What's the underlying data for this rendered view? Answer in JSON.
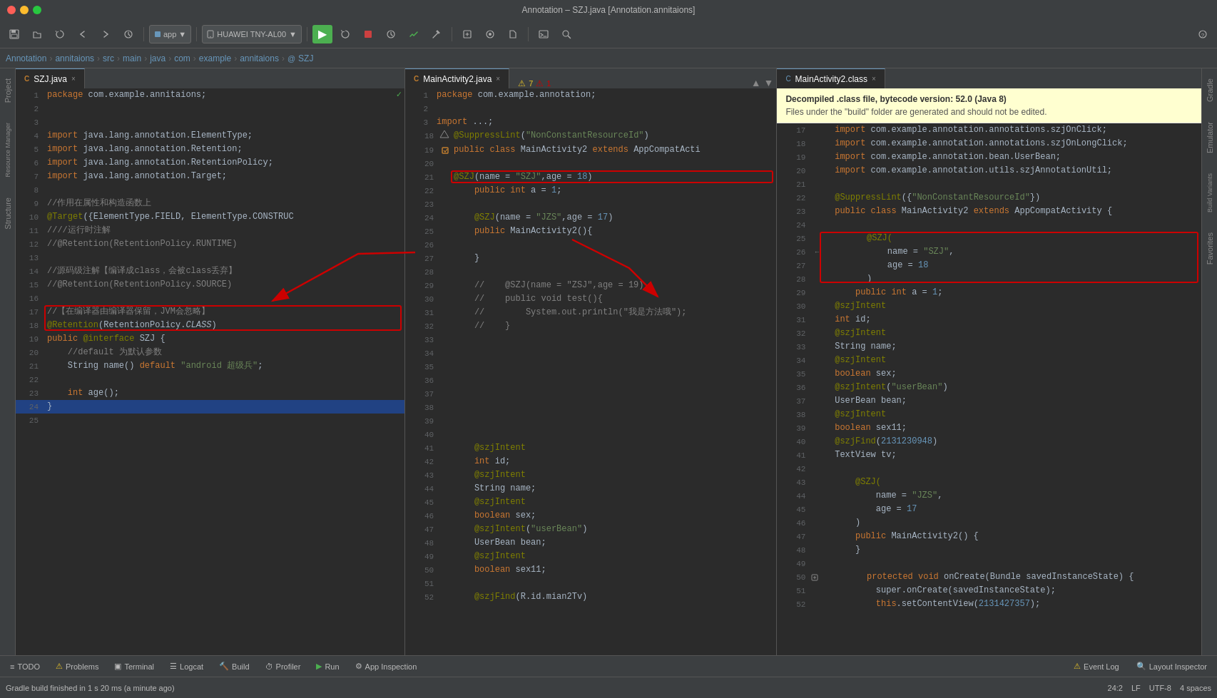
{
  "window": {
    "title": "Annotation – SZJ.java [Annotation.annitaions]"
  },
  "toolbar": {
    "app_label": "app",
    "app_dropdown_arrow": "▼",
    "device_label": "HUAWEI TNY-AL00",
    "device_arrow": "▼",
    "run_icon": "▶",
    "save_icon": "💾",
    "undo_icon": "↩",
    "redo_icon": "↪",
    "sync_icon": "⟳"
  },
  "breadcrumb": {
    "items": [
      "Annotation",
      "annitaions",
      "src",
      "main",
      "java",
      "com",
      "example",
      "annitaions",
      "SZJ"
    ]
  },
  "tabs": {
    "pane1": {
      "label": "SZJ.java",
      "type": "java",
      "active": true
    },
    "pane2": {
      "label": "MainActivity2.java",
      "type": "java",
      "active": false
    },
    "pane3": {
      "label": "MainActivity2.class",
      "type": "class",
      "active": false
    }
  },
  "pane1_code": [
    {
      "n": 1,
      "t": "package com.example.annitaions;",
      "kw": [
        "package"
      ]
    },
    {
      "n": 2,
      "t": ""
    },
    {
      "n": 3,
      "t": ""
    },
    {
      "n": 4,
      "t": "import java.lang.annotation.ElementType;",
      "kw": [
        "import"
      ]
    },
    {
      "n": 5,
      "t": "import java.lang.annotation.Retention;",
      "kw": [
        "import"
      ]
    },
    {
      "n": 6,
      "t": "import java.lang.annotation.RetentionPolicy;",
      "kw": [
        "import"
      ]
    },
    {
      "n": 7,
      "t": "import java.lang.annotation.Target;",
      "kw": [
        "import"
      ]
    },
    {
      "n": 8,
      "t": ""
    },
    {
      "n": 9,
      "t": "//作用在属性和构造函数上",
      "comment": true
    },
    {
      "n": 10,
      "t": "@Target({ElementType.FIELD, ElementType.CONSTRUC"
    },
    {
      "n": 11,
      "t": "////运行时注解",
      "comment": true
    },
    {
      "n": 12,
      "t": "//@Retention(RetentionPolicy.RUNTIME)",
      "comment": true
    },
    {
      "n": 13,
      "t": ""
    },
    {
      "n": 14,
      "t": "//源码级注解【编译成class，会被class丢弃】",
      "comment": true
    },
    {
      "n": 15,
      "t": "//@Retention(RetentionPolicy.SOURCE)",
      "comment": true
    },
    {
      "n": 16,
      "t": ""
    },
    {
      "n": 17,
      "t": "//【在编译器由编译器保留，JVM会忽略】",
      "comment": true,
      "boxed": true
    },
    {
      "n": 18,
      "t": "@Retention(RetentionPolicy.CLASS)",
      "ann": true,
      "boxed": true
    },
    {
      "n": 19,
      "t": "public @interface SZJ {",
      "kw": [
        "public",
        "@interface"
      ]
    },
    {
      "n": 20,
      "t": "    //default 为默认参数",
      "comment": true
    },
    {
      "n": 21,
      "t": "    String name() default \"android 超级兵\";"
    },
    {
      "n": 22,
      "t": ""
    },
    {
      "n": 23,
      "t": "    int age();"
    },
    {
      "n": 24,
      "t": "}",
      "selected": true
    },
    {
      "n": 25,
      "t": ""
    }
  ],
  "pane2_code": [
    {
      "n": 1,
      "t": "package com.example.annotation;"
    },
    {
      "n": 2,
      "t": ""
    },
    {
      "n": 3,
      "t": "import ..."
    },
    {
      "n": 18,
      "t": "@SuppressLint(\"NonConstantResourceId\")"
    },
    {
      "n": 19,
      "t": "public class MainActivity2 extends AppCompatActi"
    },
    {
      "n": 20,
      "t": ""
    },
    {
      "n": 21,
      "t": "    @SZJ(name = \"SZJ\",age = 18)",
      "boxed": true,
      "boxed_color": "#cc0000"
    },
    {
      "n": 22,
      "t": "    public int a = 1;"
    },
    {
      "n": 23,
      "t": ""
    },
    {
      "n": 24,
      "t": "    @SZJ(name = \"JZS\",age = 17)"
    },
    {
      "n": 25,
      "t": "    public MainActivity2(){"
    },
    {
      "n": 26,
      "t": ""
    },
    {
      "n": 27,
      "t": "    }"
    },
    {
      "n": 28,
      "t": ""
    },
    {
      "n": 29,
      "t": "    //    @SZJ(name = \"ZSJ\",age = 19)",
      "comment": true
    },
    {
      "n": 30,
      "t": "    //    public void test(){",
      "comment": true
    },
    {
      "n": 31,
      "t": "    //        System.out.println(\"我是方法哦\");",
      "comment": true
    },
    {
      "n": 32,
      "t": "    //    }",
      "comment": true
    },
    {
      "n": 33,
      "t": ""
    },
    {
      "n": 34,
      "t": ""
    },
    {
      "n": 35,
      "t": ""
    },
    {
      "n": 36,
      "t": ""
    },
    {
      "n": 37,
      "t": ""
    },
    {
      "n": 38,
      "t": ""
    },
    {
      "n": 39,
      "t": ""
    },
    {
      "n": 40,
      "t": ""
    },
    {
      "n": 41,
      "t": "    @szjIntent"
    },
    {
      "n": 42,
      "t": "    int id;"
    },
    {
      "n": 43,
      "t": "    @szjIntent"
    },
    {
      "n": 44,
      "t": "    String name;"
    },
    {
      "n": 45,
      "t": "    @szjIntent"
    },
    {
      "n": 46,
      "t": "    boolean sex;"
    },
    {
      "n": 47,
      "t": "    @szjIntent(\"userBean\")"
    },
    {
      "n": 48,
      "t": "    UserBean bean;"
    },
    {
      "n": 49,
      "t": "    @szjIntent"
    },
    {
      "n": 50,
      "t": "    boolean sex11;"
    },
    {
      "n": 51,
      "t": ""
    },
    {
      "n": 52,
      "t": "    @szjFind(R.id.mian2Tv)"
    }
  ],
  "pane3_code": [
    {
      "n": 17,
      "t": "    import com.example.annotation.annotations.szjOnClick;"
    },
    {
      "n": 18,
      "t": "    import com.example.annotation.annotations.szjOnLongClick;"
    },
    {
      "n": 19,
      "t": "    import com.example.annotation.bean.UserBean;"
    },
    {
      "n": 20,
      "t": "    import com.example.annotation.utils.szjAnnotationUtil;"
    },
    {
      "n": 21,
      "t": ""
    },
    {
      "n": 22,
      "t": "    @SuppressLint({\"NonConstantResourceId\"})"
    },
    {
      "n": 23,
      "t": "    public class MainActivity2 extends AppCompatActivity {"
    },
    {
      "n": 24,
      "t": ""
    },
    {
      "n": 25,
      "t": "        @SZJ(",
      "boxed": true
    },
    {
      "n": 26,
      "t": "            name = \"SZJ\",",
      "boxed": true
    },
    {
      "n": 27,
      "t": "            age = 18",
      "boxed": true
    },
    {
      "n": 28,
      "t": "        )",
      "boxed": true
    },
    {
      "n": 29,
      "t": "        public int a = 1;"
    },
    {
      "n": 30,
      "t": "    @szjIntent"
    },
    {
      "n": 31,
      "t": "    int id;"
    },
    {
      "n": 32,
      "t": "    @szjIntent"
    },
    {
      "n": 33,
      "t": "    String name;"
    },
    {
      "n": 34,
      "t": "    @szjIntent"
    },
    {
      "n": 35,
      "t": "    boolean sex;"
    },
    {
      "n": 36,
      "t": "    @szjIntent(\"userBean\")"
    },
    {
      "n": 37,
      "t": "    UserBean bean;"
    },
    {
      "n": 38,
      "t": "    @szjIntent"
    },
    {
      "n": 39,
      "t": "    boolean sex11;"
    },
    {
      "n": 40,
      "t": "    @szjFind(2131230948)"
    },
    {
      "n": 41,
      "t": "    TextView tv;"
    },
    {
      "n": 42,
      "t": ""
    },
    {
      "n": 43,
      "t": "        @SZJ("
    },
    {
      "n": 44,
      "t": "            name = \"JZS\","
    },
    {
      "n": 45,
      "t": "            age = 17"
    },
    {
      "n": 46,
      "t": "        )"
    },
    {
      "n": 47,
      "t": "        public MainActivity2() {"
    },
    {
      "n": 48,
      "t": "        }"
    },
    {
      "n": 49,
      "t": ""
    },
    {
      "n": 50,
      "t": "        protected void onCreate(Bundle savedInstanceState) {"
    },
    {
      "n": 51,
      "t": "            super.onCreate(savedInstanceState);"
    },
    {
      "n": 52,
      "t": "            this.setContentView(2131427357);"
    }
  ],
  "decompile_notice": {
    "title": "Decompiled .class file, bytecode version: 52.0 (Java 8)",
    "text": "Files under the \"build\" folder are generated and should not be edited."
  },
  "status_bar": {
    "build_text": "Gradle build finished in 1 s 20 ms (a minute ago)",
    "position": "24:2",
    "line_ending": "LF",
    "encoding": "UTF-8",
    "indent": "4 spaces"
  },
  "bottom_tabs": [
    {
      "icon": "≡",
      "label": "TODO"
    },
    {
      "icon": "⚠",
      "label": "Problems"
    },
    {
      "icon": "▣",
      "label": "Terminal"
    },
    {
      "icon": "☰",
      "label": "Logcat"
    },
    {
      "icon": "🔨",
      "label": "Build"
    },
    {
      "icon": "⏱",
      "label": "Profiler"
    },
    {
      "icon": "▶",
      "label": "Run"
    },
    {
      "icon": "⚙",
      "label": "App Inspection"
    }
  ],
  "bottom_right_tabs": [
    {
      "icon": "📋",
      "label": "Event Log"
    },
    {
      "icon": "🔍",
      "label": "Layout Inspector"
    }
  ],
  "sidebar_left": [
    "Project",
    "Resource Manager",
    "Structure"
  ],
  "sidebar_right": [
    "Gradle",
    "Emulator",
    "Build Variants",
    "Favorites"
  ],
  "colors": {
    "accent": "#6897bb",
    "keyword": "#cc7832",
    "string": "#6a8759",
    "annotation": "#808000",
    "comment": "#808080",
    "number": "#6897bb",
    "highlight": "#3a3a3a",
    "selection": "#214283",
    "box_red": "#cc0000"
  }
}
